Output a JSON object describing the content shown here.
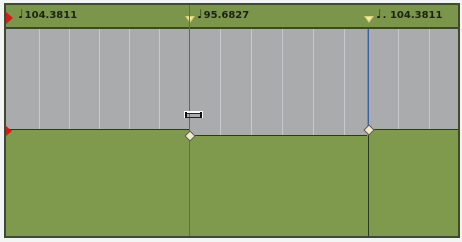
{
  "tempo_ruler": {
    "markers": [
      {
        "value": "104.3811",
        "note_icon": "quarter-note-icon",
        "note_glyph": "♩"
      },
      {
        "value": "95.6827",
        "note_icon": "quarter-note-icon",
        "note_glyph": "♩"
      },
      {
        "value": ". 104.3811",
        "note_icon": "quarter-note-icon",
        "note_glyph": "♩"
      }
    ]
  },
  "colors": {
    "ruler_bg": "#7b954a",
    "region_bg": "#7f9a4c",
    "tempo_area_bg": "#a9abac",
    "playhead": "#e4302a",
    "bar_line": "#3d5fa5"
  }
}
